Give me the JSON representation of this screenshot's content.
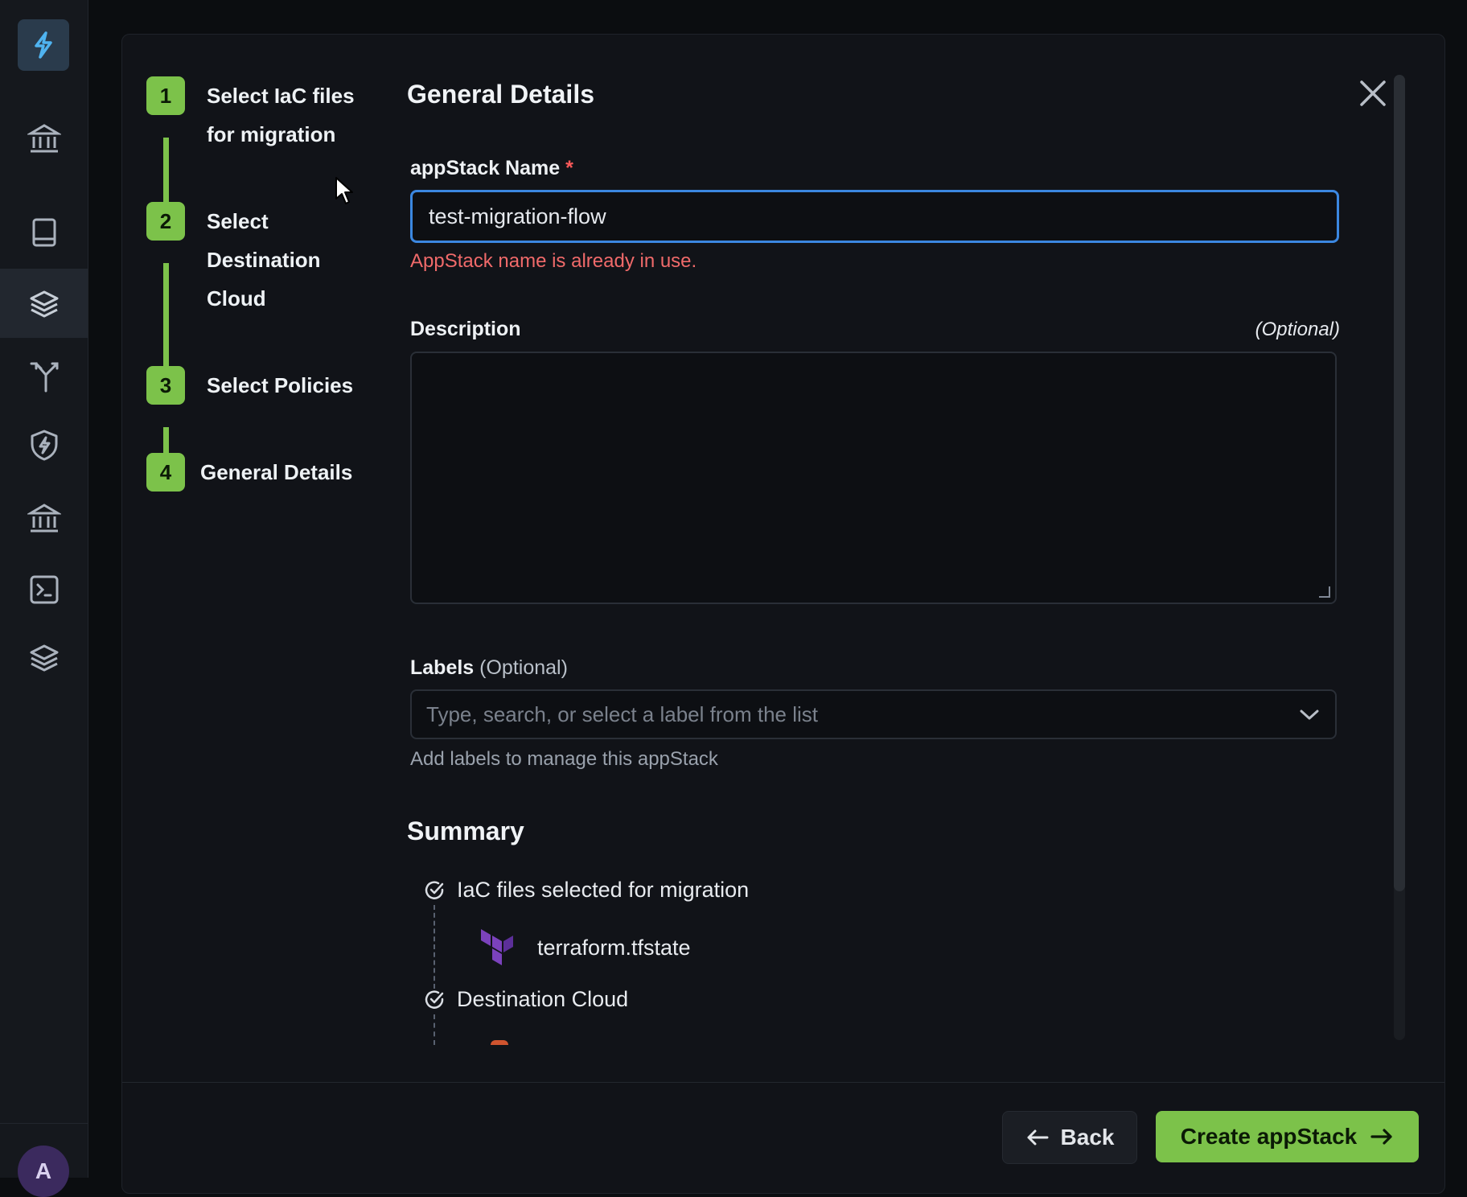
{
  "stepper": {
    "steps": [
      {
        "number": "1",
        "label_line1": "Select IaC files",
        "label_line2": "for migration"
      },
      {
        "number": "2",
        "label_line1": "Select",
        "label_line2": "Destination",
        "label_line3": "Cloud"
      },
      {
        "number": "3",
        "label": "Select Policies"
      },
      {
        "number": "4",
        "label": "General Details"
      }
    ]
  },
  "form": {
    "title": "General Details",
    "name_label": "appStack Name",
    "required_mark": "*",
    "name_value": "test-migration-flow",
    "name_error": "AppStack name is already in use.",
    "description_label": "Description",
    "description_optional": "(Optional)",
    "labels_label": "Labels",
    "labels_optional": "(Optional)",
    "labels_placeholder": "Type, search, or select a label from the list",
    "labels_helper": "Add labels to manage this appStack"
  },
  "summary": {
    "title": "Summary",
    "iac_heading": "IaC files selected for migration",
    "iac_file": "terraform.tfstate",
    "destination_heading": "Destination Cloud"
  },
  "footer": {
    "back_label": "Back",
    "create_label": "Create appStack"
  },
  "icons": {
    "rail": [
      "bank-icon",
      "book-icon",
      "layers-icon",
      "fork-icon",
      "shield-bolt-icon",
      "bank-icon",
      "terminal-icon",
      "layers-icon"
    ]
  },
  "colors": {
    "accent_green": "#7cc24a",
    "focus_blue": "#3b87e0",
    "error_red": "#f06a6a",
    "terraform_purple": "#7b42bc"
  },
  "user": {
    "avatar_initial": "A"
  }
}
